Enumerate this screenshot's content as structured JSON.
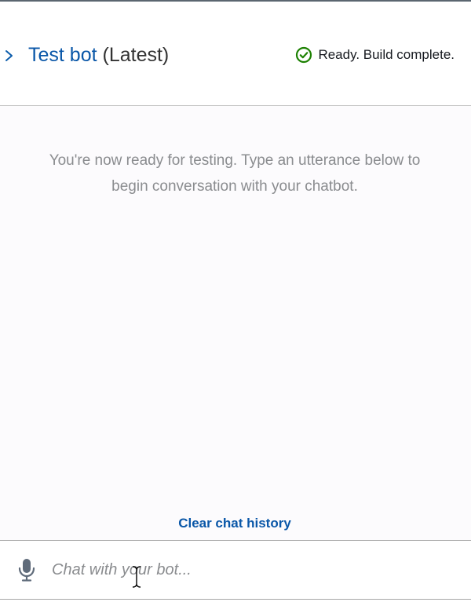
{
  "header": {
    "title_link": "Test bot",
    "title_suffix": " (Latest)",
    "status_text": "Ready. Build complete.",
    "status_icon": "check-circle-icon",
    "expand_icon": "chevron-right-icon"
  },
  "conversation": {
    "welcome_message": "You're now ready for testing. Type an utterance below to begin conversation with your chatbot.",
    "clear_history_label": "Clear chat history"
  },
  "input": {
    "placeholder": "Chat with your bot...",
    "value": "",
    "mic_icon": "microphone-icon"
  },
  "colors": {
    "link": "#0a57a8",
    "success": "#1d8102",
    "muted_text": "#8a8c8f"
  }
}
